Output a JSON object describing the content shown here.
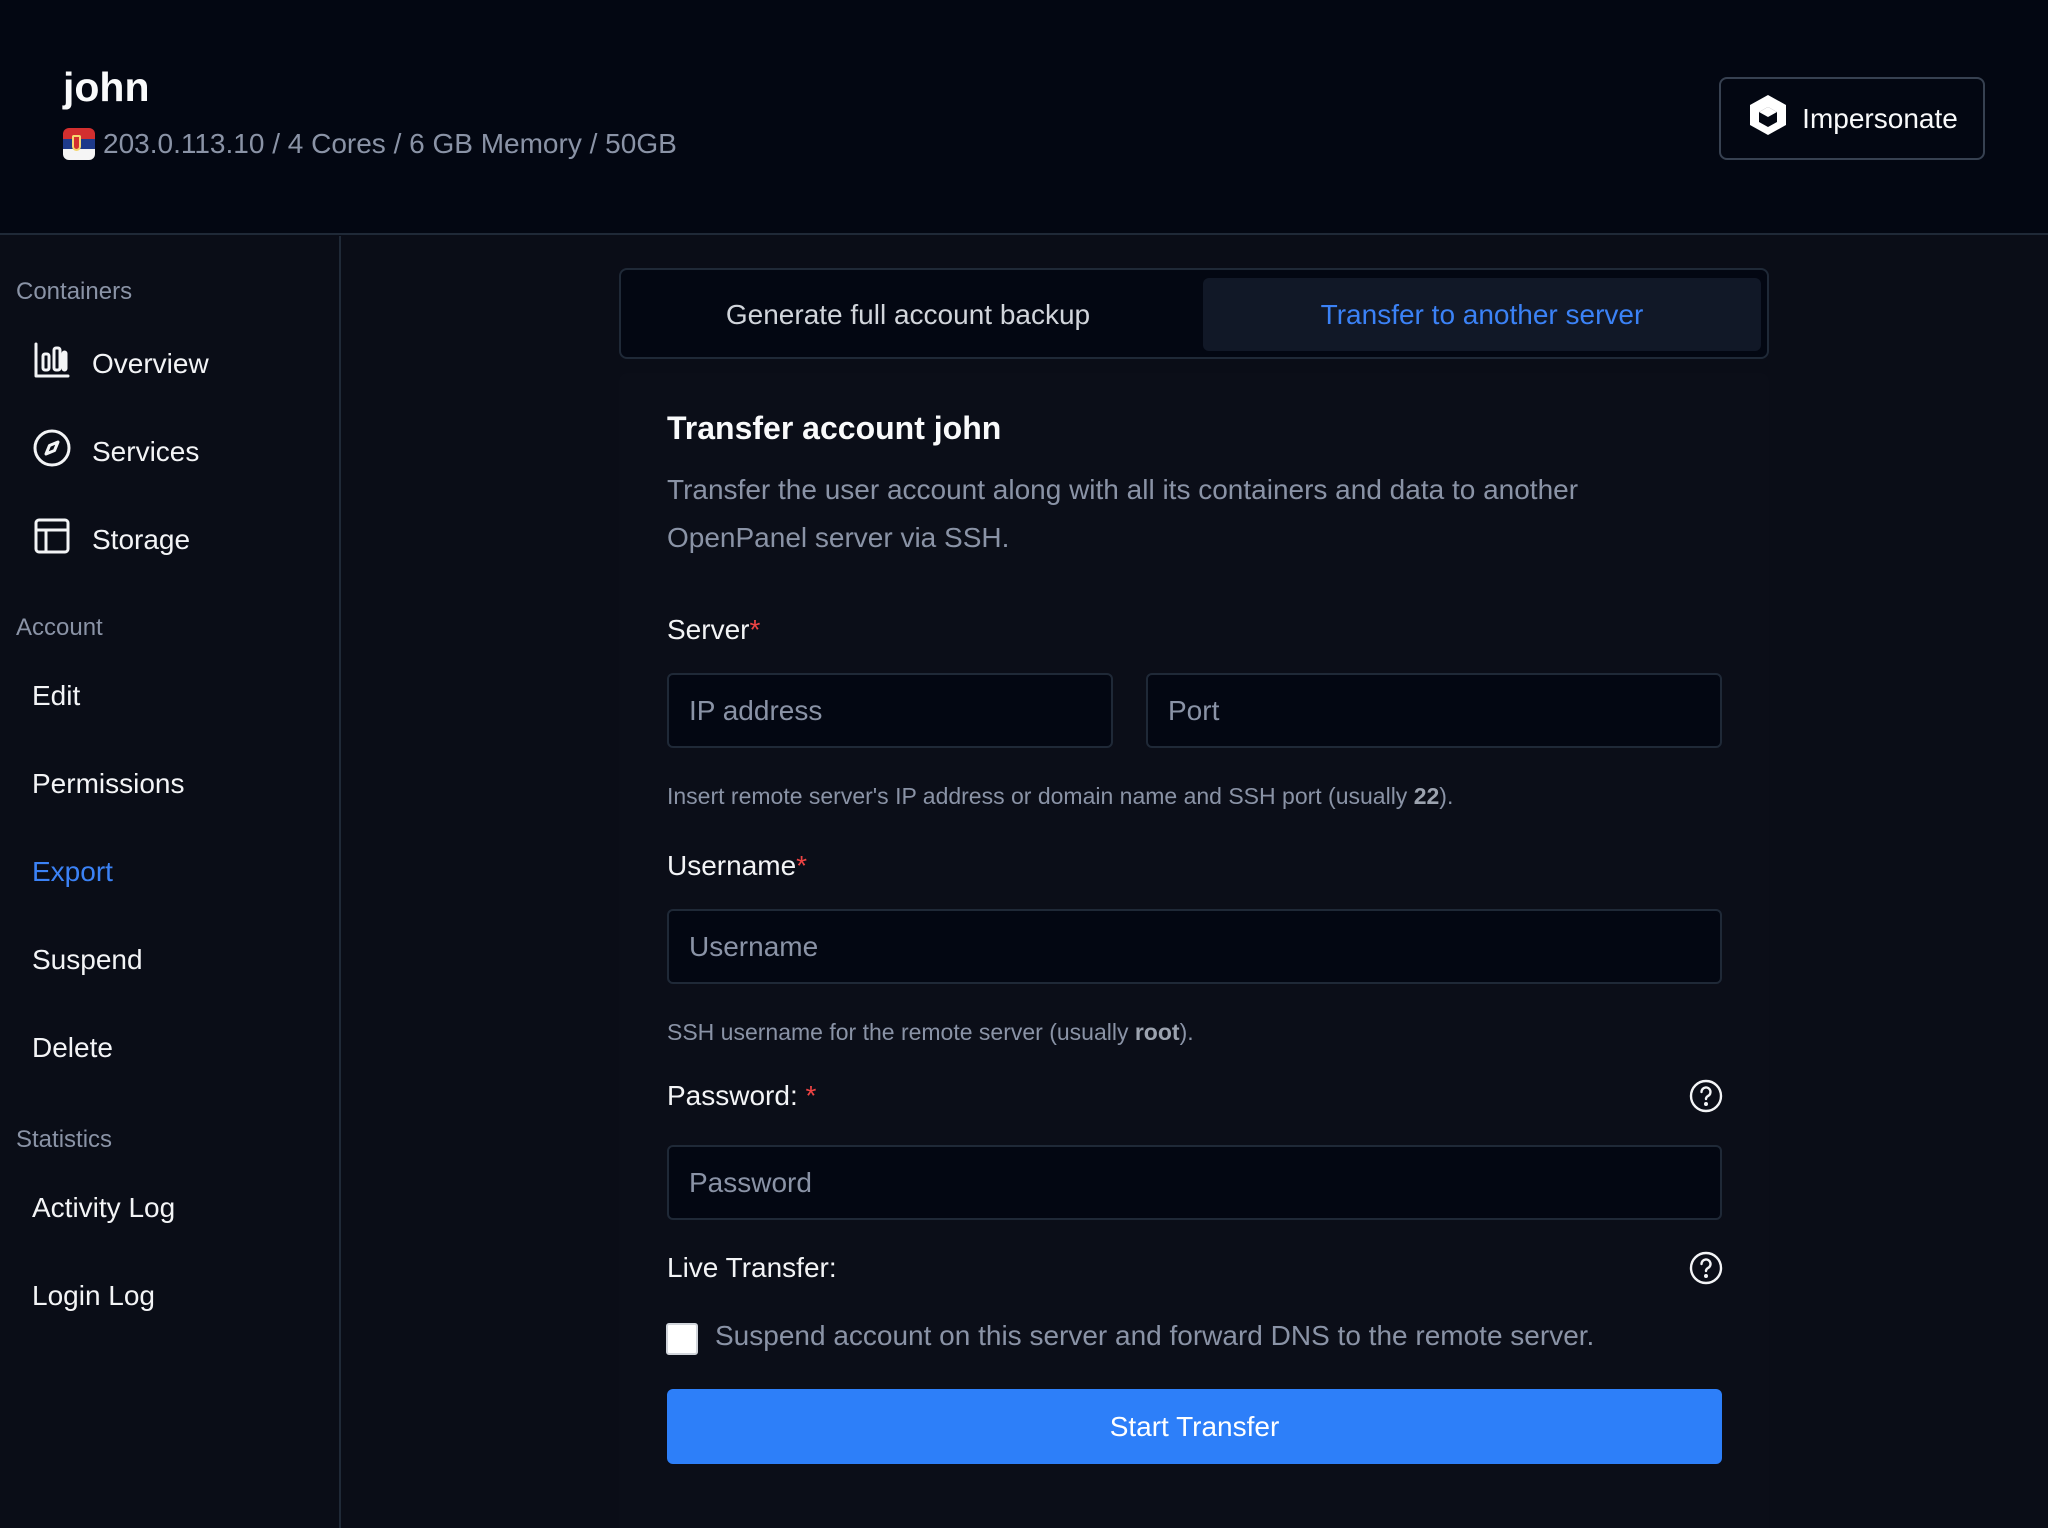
{
  "header": {
    "username": "john",
    "meta": "203.0.113.10 / 4 Cores / 6 GB Memory / 50GB",
    "flag_icon": "serbia-flag-icon",
    "impersonate_label": "Impersonate"
  },
  "sidebar": {
    "sections": {
      "containers": "Containers",
      "account": "Account",
      "statistics": "Statistics"
    },
    "items": {
      "overview": "Overview",
      "services": "Services",
      "storage": "Storage",
      "edit": "Edit",
      "permissions": "Permissions",
      "export": "Export",
      "suspend": "Suspend",
      "delete": "Delete",
      "activity_log": "Activity Log",
      "login_log": "Login Log"
    },
    "active_item": "Export"
  },
  "tabs": {
    "backup": "Generate full account backup",
    "transfer": "Transfer to another server",
    "active": "Transfer to another server"
  },
  "form": {
    "title": "Transfer account john",
    "description": "Transfer the user account along with all its containers and data to another OpenPanel server via SSH.",
    "server_label": "Server",
    "required_mark": "*",
    "ip_placeholder": "IP address",
    "port_placeholder": "Port",
    "server_hint_pre": "Insert remote server's IP address or domain name and SSH port (usually ",
    "server_hint_bold": "22",
    "server_hint_post": ").",
    "username_label": "Username",
    "username_placeholder": "Username",
    "username_hint_pre": "SSH username for the remote server (usually ",
    "username_hint_bold": "root",
    "username_hint_post": ").",
    "password_label": "Password: ",
    "password_placeholder": "Password",
    "live_transfer_label": "Live Transfer:",
    "live_transfer_checkbox": "Suspend account on this server and forward DNS to the remote server.",
    "live_transfer_checked": false,
    "submit_label": "Start Transfer"
  },
  "colors": {
    "accent": "#2d7ff9",
    "active_link": "#3b82f6",
    "required": "#ef4444",
    "background": "#0a0d17"
  }
}
